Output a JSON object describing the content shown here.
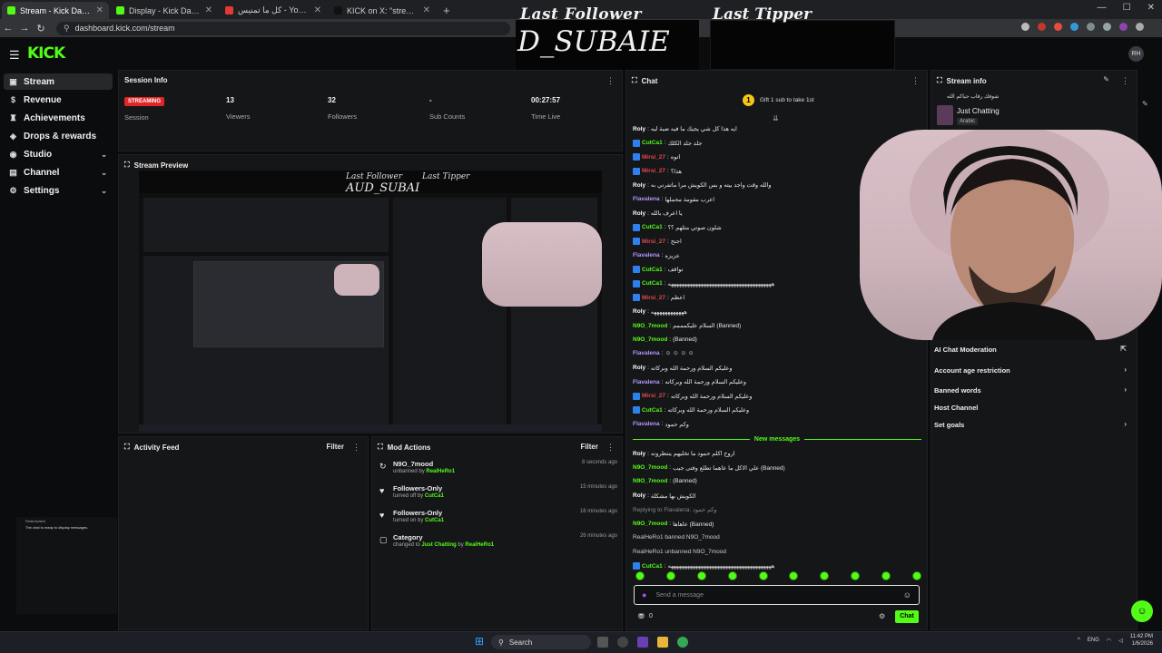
{
  "browser": {
    "tabs": [
      {
        "title": "Stream - Kick Dashboard",
        "color": "#53fc18"
      },
      {
        "title": "Display - Kick Dashboard",
        "color": "#53fc18"
      },
      {
        "title": "كل ما تمنيس - YouTube Music",
        "color": "#e53935"
      },
      {
        "title": "KICK on X: \"streaming on twit...",
        "color": "#111111"
      }
    ],
    "url": "dashboard.kick.com/stream"
  },
  "overlay": {
    "last_follower_label": "Last Follower",
    "last_tipper_label": "Last Tipper",
    "last_follower_name": "D_SUBAIE"
  },
  "header": {
    "logo": "KICK",
    "profile_initials": "RH"
  },
  "sidebar": {
    "items": [
      {
        "label": "Stream",
        "icon": "stream-icon",
        "glyph": "▣",
        "chevron": false
      },
      {
        "label": "Revenue",
        "icon": "revenue-icon",
        "glyph": "$",
        "chevron": false
      },
      {
        "label": "Achievements",
        "icon": "trophy-icon",
        "glyph": "♜",
        "chevron": false
      },
      {
        "label": "Drops & rewards",
        "icon": "gift-icon",
        "glyph": "◈",
        "chevron": false
      },
      {
        "label": "Studio",
        "icon": "studio-icon",
        "glyph": "◉",
        "chevron": true
      },
      {
        "label": "Channel",
        "icon": "channel-icon",
        "glyph": "▤",
        "chevron": true
      },
      {
        "label": "Settings",
        "icon": "gear-icon",
        "glyph": "⚙",
        "chevron": true
      }
    ],
    "preview_line1": "Realmwatch",
    "preview_line2": "The chat is ready to display messages."
  },
  "session": {
    "title": "Session Info",
    "status_badge": "STREAMING",
    "stats": [
      {
        "value": "",
        "label": "Session"
      },
      {
        "value": "13",
        "label": "Viewers"
      },
      {
        "value": "32",
        "label": "Followers"
      },
      {
        "value": "-",
        "label": "Sub Counts"
      },
      {
        "value": "00:27:57",
        "label": "Time Live"
      }
    ]
  },
  "preview": {
    "title": "Stream Preview",
    "mini_follower": "Last Follower",
    "mini_tipper": "Last Tipper",
    "mini_name": "AUD_SUBAI"
  },
  "activity": {
    "title": "Activity Feed",
    "filter": "Filter"
  },
  "mod_actions": {
    "title": "Mod Actions",
    "filter": "Filter",
    "rows": [
      {
        "icon": "unban-icon",
        "glyph": "↻",
        "name": "N9O_7mood",
        "action": "unbanned by",
        "by": "RealHeRo1",
        "time": "8 seconds ago"
      },
      {
        "icon": "heart-icon",
        "glyph": "♥",
        "name": "Followers-Only",
        "action": "turned off by",
        "by": "CutCa1",
        "time": "15 minutes ago"
      },
      {
        "icon": "heart-icon",
        "glyph": "♥",
        "name": "Followers-Only",
        "action": "turned on by",
        "by": "CutCa1",
        "time": "16 minutes ago"
      },
      {
        "icon": "category-icon",
        "glyph": "▢",
        "name": "Category",
        "action": "changed to",
        "by": "Just Chatting",
        "by2": "by",
        "by3": "RealHeRo1",
        "time": "26 minutes ago"
      }
    ]
  },
  "chat": {
    "title": "Chat",
    "gift_prompt": "Gift 1 sub to take 1st",
    "new_messages": "New messages",
    "messages": [
      {
        "user": "Roly",
        "color": "#ffffff",
        "badge": false,
        "text": "ايه هذا كل شي يجيك ما فيه ضبة ليه"
      },
      {
        "user": "CutCa1",
        "color": "#53fc18",
        "badge": true,
        "text": "جلد جلد الكلك"
      },
      {
        "user": "Mirsi_27",
        "color": "#e5484d",
        "badge": true,
        "text": "اتوه"
      },
      {
        "user": "Mirsi_27",
        "color": "#e5484d",
        "badge": true,
        "text": "هذا؟"
      },
      {
        "user": "Roly",
        "color": "#ffffff",
        "badge": false,
        "text": "والله وقت واجد بيته و بس الكويش مرا ماتفرني به"
      },
      {
        "user": "Flavalena",
        "color": "#b497ff",
        "badge": false,
        "text": "اعرب مقومة محملها"
      },
      {
        "user": "Roly",
        "color": "#ffffff",
        "badge": false,
        "text": "يا اعرف بالله"
      },
      {
        "user": "CutCa1",
        "color": "#53fc18",
        "badge": true,
        "text": "شلون صوتي مثلهم ؟؟"
      },
      {
        "user": "Mirsi_27",
        "color": "#e5484d",
        "badge": true,
        "text": "اجنح"
      },
      {
        "user": "Flavalena",
        "color": "#b497ff",
        "badge": false,
        "text": "عزيزه"
      },
      {
        "user": "CutCa1",
        "color": "#53fc18",
        "badge": true,
        "text": "تواقف"
      },
      {
        "user": "CutCa1",
        "color": "#53fc18",
        "badge": true,
        "text": "ههههههههههههههههههههههههههههههههههههههه"
      },
      {
        "user": "Mirsi_27",
        "color": "#e5484d",
        "badge": true,
        "text": "اعظم"
      },
      {
        "user": "Roly",
        "color": "#ffffff",
        "badge": false,
        "text": "ههههههههههههه"
      },
      {
        "user": "N9O_7mood",
        "color": "#53fc18",
        "badge": false,
        "text": "السلام عليكمممم (Banned)"
      },
      {
        "user": "N9O_7mood",
        "color": "#53fc18",
        "badge": false,
        "text": "(Banned)"
      },
      {
        "user": "Flavalena",
        "color": "#b497ff",
        "badge": false,
        "text": "☺ ☺ ☺ ☺"
      },
      {
        "user": "Roly",
        "color": "#ffffff",
        "badge": false,
        "text": "وعليكم السلام ورحمة الله وبركاته"
      },
      {
        "user": "Flavalena",
        "color": "#b497ff",
        "badge": false,
        "text": "وعليكم السلام ورحمة الله وبركاته"
      },
      {
        "user": "Mirsi_27",
        "color": "#e5484d",
        "badge": true,
        "text": "وعليكم السلام ورحمة الله وبركاته"
      },
      {
        "user": "CutCa1",
        "color": "#53fc18",
        "badge": true,
        "text": "وعليكم السلام ورحمة الله وبركاته"
      },
      {
        "user": "Flavalena",
        "color": "#b497ff",
        "badge": false,
        "text": "وكم حمود"
      }
    ],
    "new": [
      {
        "user": "Roly",
        "color": "#ffffff",
        "badge": false,
        "text": "اروح اكلم حمود ما تخليهم ينتظرونه"
      },
      {
        "user": "N9O_7mood",
        "color": "#53fc18",
        "badge": false,
        "text": "علي الاكل ما عاهما تطلع وفتى جيب (Banned)"
      },
      {
        "user": "N9O_7mood",
        "color": "#53fc18",
        "badge": false,
        "text": "(Banned)"
      },
      {
        "user": "Roly",
        "color": "#ffffff",
        "badge": false,
        "text": "الكويش بها مشكلة"
      },
      {
        "user": "",
        "color": "#888888",
        "badge": false,
        "text": "Replying to Flavalena: وكم حمود"
      },
      {
        "user": "N9O_7mood",
        "color": "#53fc18",
        "badge": false,
        "text": "عاهاها (Banned)"
      },
      {
        "user": "",
        "color": "#cccccc",
        "badge": false,
        "text": "RealHeRo1 banned N9O_7mood"
      },
      {
        "user": "",
        "color": "#cccccc",
        "badge": false,
        "text": "RealHeRo1 unbanned N9O_7mood"
      },
      {
        "user": "CutCa1",
        "color": "#53fc18",
        "badge": true,
        "text": "ههههههههههههههههههههههههههههههههههههههه"
      }
    ],
    "input_placeholder": "Send a message",
    "points": "0",
    "send_label": "Chat"
  },
  "stream_info": {
    "title": "Stream info",
    "stream_title": "شوفك رقاب حياكم الله",
    "category": "Just Chatting",
    "language": "Arabic",
    "rows": [
      {
        "label": "AI Chat Moderation",
        "arrow": "⇱"
      },
      {
        "label": "Account age restriction",
        "arrow": "›"
      },
      {
        "label": "Banned words",
        "arrow": "›"
      },
      {
        "label": "Host Channel",
        "arrow": ""
      },
      {
        "label": "Set goals",
        "arrow": "›"
      }
    ]
  },
  "taskbar": {
    "search": "Search",
    "lang": "ENG",
    "time": "11:42 PM",
    "date": "1/6/2026"
  }
}
